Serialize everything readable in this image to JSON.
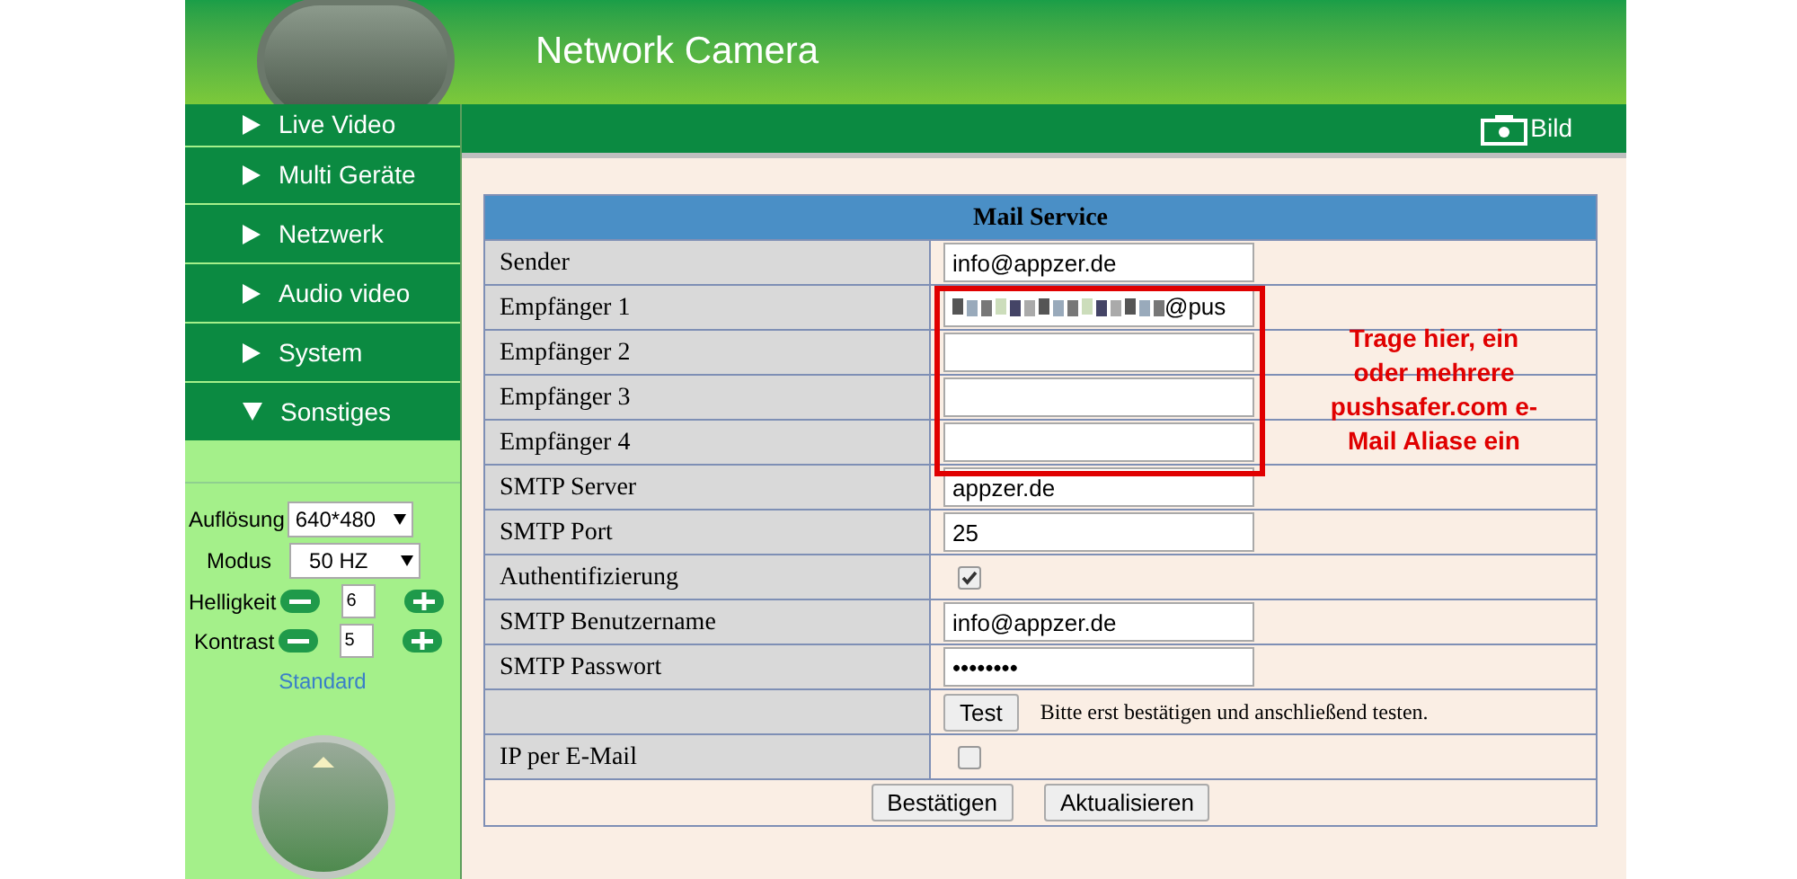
{
  "header": {
    "title": "Network Camera"
  },
  "toolbar": {
    "snapshot_label": "Bild"
  },
  "sidebar": {
    "items": [
      {
        "label": "Live Video",
        "expanded": false
      },
      {
        "label": "Multi Geräte",
        "expanded": false
      },
      {
        "label": "Netzwerk",
        "expanded": false
      },
      {
        "label": "Audio video",
        "expanded": false
      },
      {
        "label": "System",
        "expanded": false
      },
      {
        "label": "Sonstiges",
        "expanded": true
      }
    ],
    "controls": {
      "resolution_label": "Auflösung",
      "resolution": "640*480",
      "mode_label": "Modus",
      "mode": "50 HZ",
      "brightness_label": "Helligkeit",
      "brightness": "6",
      "contrast_label": "Kontrast",
      "contrast": "5",
      "default_link": "Standard"
    }
  },
  "form": {
    "title": "Mail Service",
    "rows": [
      {
        "kind": "text",
        "label": "Sender",
        "value": "info@appzer.de"
      },
      {
        "kind": "redacted",
        "label": "Empfänger 1",
        "value": "@pus"
      },
      {
        "kind": "text",
        "label": "Empfänger 2",
        "value": ""
      },
      {
        "kind": "text",
        "label": "Empfänger 3",
        "value": ""
      },
      {
        "kind": "text",
        "label": "Empfänger 4",
        "value": ""
      },
      {
        "kind": "text",
        "label": "SMTP Server",
        "value": "appzer.de"
      },
      {
        "kind": "text",
        "label": "SMTP Port",
        "value": "25"
      },
      {
        "kind": "checkbox",
        "label": "Authentifizierung",
        "checked": true
      },
      {
        "kind": "text",
        "label": "SMTP Benutzername",
        "value": "info@appzer.de"
      },
      {
        "kind": "password",
        "label": "SMTP Passwort",
        "value": "••••••••"
      },
      {
        "kind": "test",
        "label": "",
        "button": "Test",
        "note": "Bitte erst bestätigen und anschließend testen."
      },
      {
        "kind": "checkbox",
        "label": "IP per E-Mail",
        "checked": false
      }
    ],
    "buttons": [
      "Bestätigen",
      "Aktualisieren"
    ]
  },
  "annotation": {
    "text": "Trage hier, ein oder mehrere pushsafer.com e-Mail Aliase ein"
  }
}
